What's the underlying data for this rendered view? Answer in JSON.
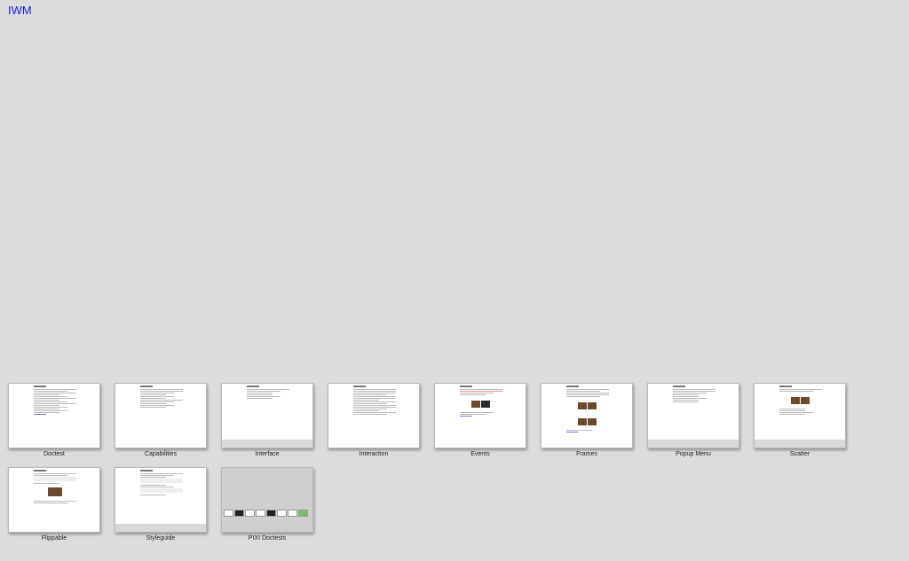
{
  "header": {
    "title": "IWM"
  },
  "tiles": [
    {
      "label": "Doctest"
    },
    {
      "label": "Capabilities"
    },
    {
      "label": "Interface"
    },
    {
      "label": "Interaction"
    },
    {
      "label": "Events"
    },
    {
      "label": "Frames"
    },
    {
      "label": "Popup Menu"
    },
    {
      "label": "Scatter"
    },
    {
      "label": "Flippable"
    },
    {
      "label": "Styleguide"
    },
    {
      "label": "PIXI Doctests"
    }
  ]
}
